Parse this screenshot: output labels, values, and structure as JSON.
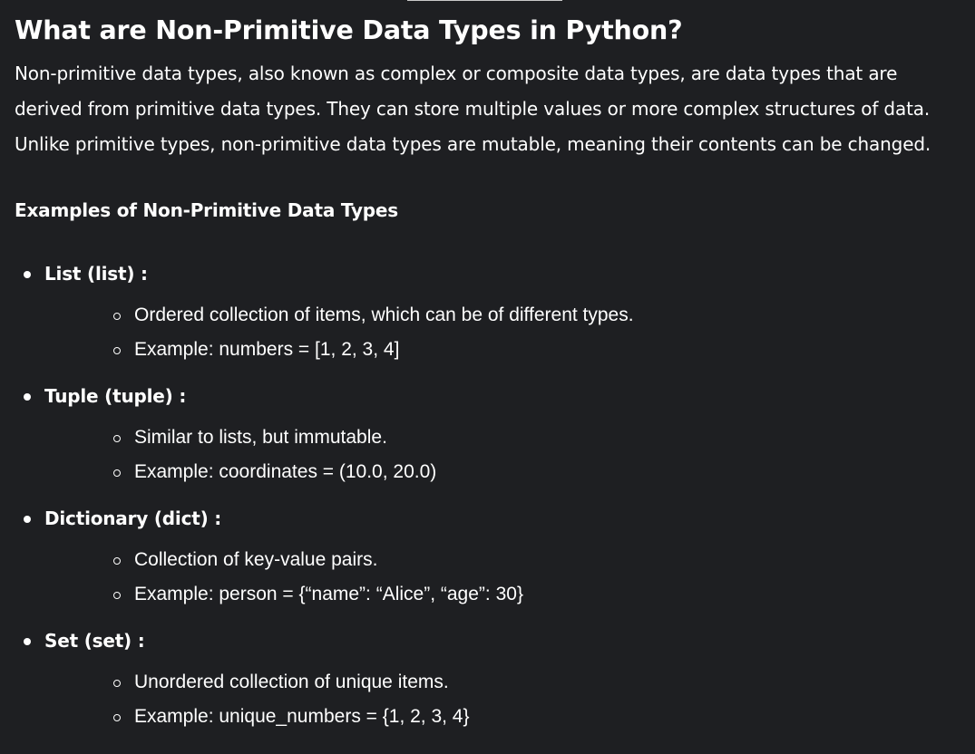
{
  "article": {
    "title": "What are Non-Primitive Data Types in Python?",
    "intro": "Non-primitive data types, also known as complex or composite data types, are data types that are derived from primitive data types. They can store multiple values or more complex structures of data. Unlike primitive types, non-primitive data types are mutable, meaning their contents can be changed.",
    "examples_heading": "Examples of Non-Primitive Data Types",
    "types": [
      {
        "label": "List (list) :",
        "description": "Ordered collection of items, which can be of different types.",
        "example": "Example: numbers = [1, 2, 3, 4]"
      },
      {
        "label": "Tuple (tuple) :",
        "description": "Similar to lists, but immutable.",
        "example": "Example: coordinates = (10.0, 20.0)"
      },
      {
        "label": "Dictionary (dict) :",
        "description": "Collection of key-value pairs.",
        "example": "Example: person = {“name”: “Alice”, “age”: 30}"
      },
      {
        "label": "Set (set) :",
        "description": "Unordered collection of unique items.",
        "example": "Example: unique_numbers = {1, 2, 3, 4}"
      }
    ]
  }
}
